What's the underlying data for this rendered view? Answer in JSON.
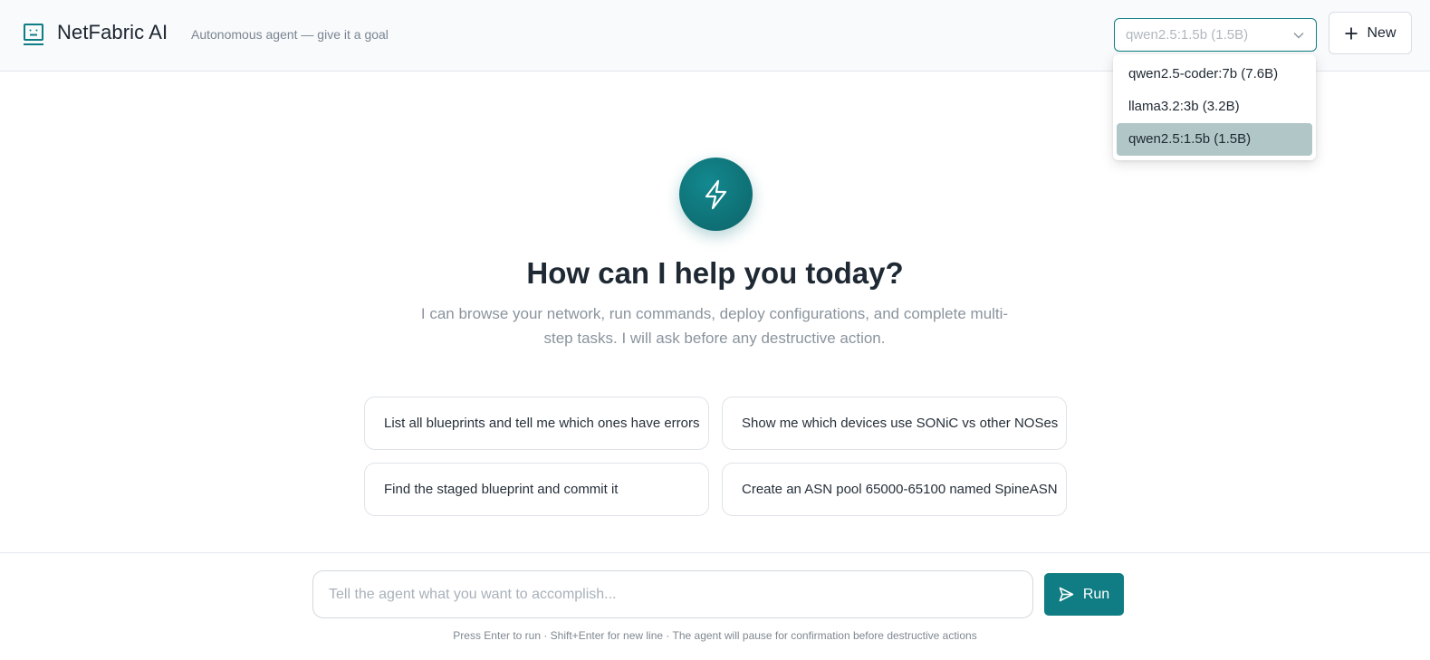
{
  "header": {
    "brand_name": "NetFabric AI",
    "tagline": "Autonomous agent — give it a goal",
    "model_select": {
      "value": "qwen2.5:1.5b (1.5B)",
      "options": [
        {
          "label": "qwen2.5-coder:7b (7.6B)",
          "selected": false
        },
        {
          "label": "llama3.2:3b (3.2B)",
          "selected": false
        },
        {
          "label": "qwen2.5:1.5b (1.5B)",
          "selected": true
        }
      ]
    },
    "new_label": "New"
  },
  "hero": {
    "icon": "lightning-bolt-icon",
    "title": "How can I help you today?",
    "subtitle": "I can browse your network, run commands, deploy configurations, and complete multi-step tasks. I will ask before any destructive action."
  },
  "suggestions": [
    "List all blueprints and tell me which ones have errors",
    "Show me which devices use SONiC vs other NOSes",
    "Find the staged blueprint and commit it",
    "Create an ASN pool 65000-65100 named SpineASN"
  ],
  "composer": {
    "placeholder": "Tell the agent what you want to accomplish...",
    "run_label": "Run",
    "hint": "Press Enter to run · Shift+Enter for new line · The agent will pause for confirmation before destructive actions"
  },
  "colors": {
    "accent": "#0f7d83",
    "selected_option_bg": "#b1c6c7",
    "header_bg": "#f8fafc"
  }
}
